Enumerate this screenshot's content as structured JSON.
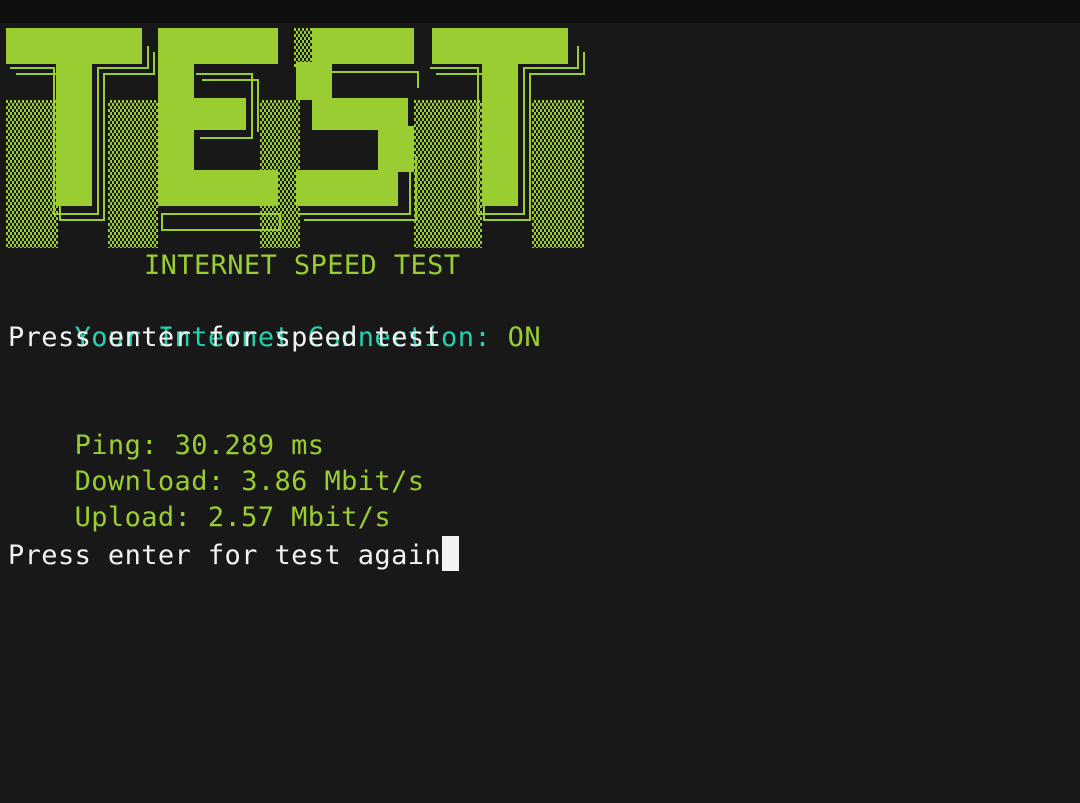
{
  "banner": {
    "word": "TEST",
    "subtitle": "INTERNET SPEED TEST"
  },
  "connection": {
    "label": "Your Internet Connection:",
    "status": "ON"
  },
  "prompt_start": "Press enter for speed test",
  "results": {
    "ping_label": "Ping:",
    "ping_value": "30.289 ms",
    "download_label": "Download:",
    "download_value": "3.86 Mbit/s",
    "upload_label": "Upload:",
    "upload_value": "2.57 Mbit/s"
  },
  "prompt_again": "Press enter for test again",
  "colors": {
    "accent_green": "#9acd32",
    "accent_cyan": "#26d1b0",
    "text_white": "#f2f2f2",
    "background": "#181818"
  }
}
